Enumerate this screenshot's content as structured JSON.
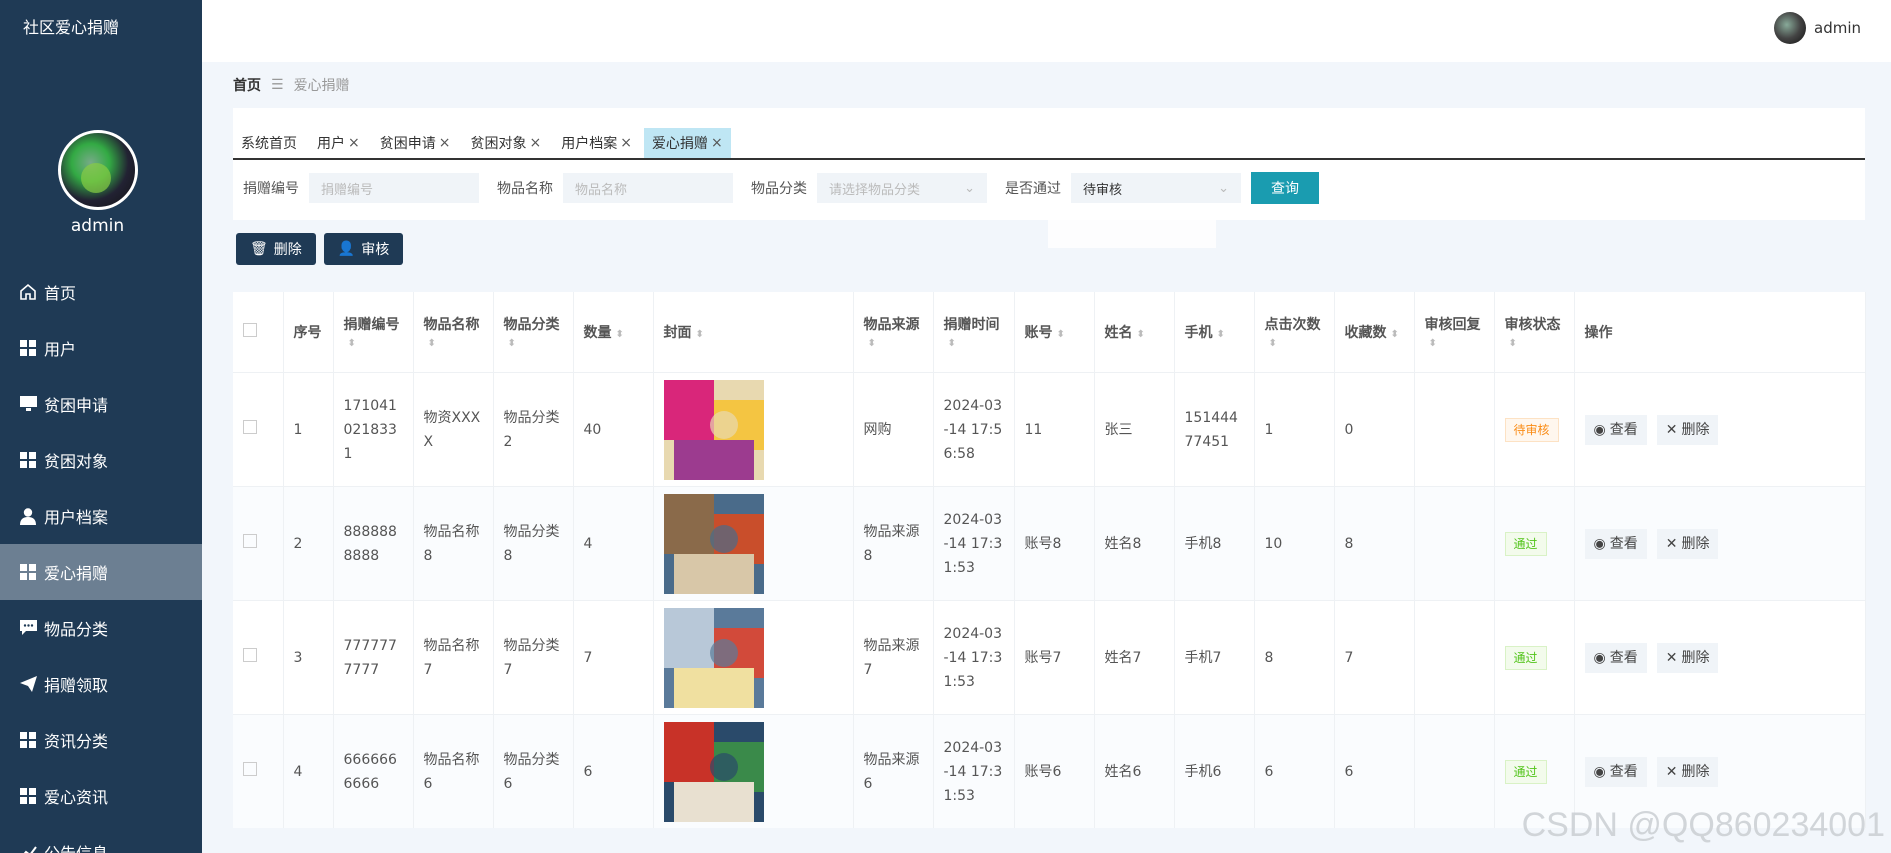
{
  "app": {
    "title": "社区爱心捐赠",
    "user": "admin"
  },
  "sidebar": {
    "items": [
      {
        "label": "首页",
        "icon": "home-icon"
      },
      {
        "label": "用户",
        "icon": "grid-icon"
      },
      {
        "label": "贫困申请",
        "icon": "monitor-icon"
      },
      {
        "label": "贫困对象",
        "icon": "grid-icon"
      },
      {
        "label": "用户档案",
        "icon": "user-icon"
      },
      {
        "label": "爱心捐赠",
        "icon": "grid-icon",
        "active": true
      },
      {
        "label": "物品分类",
        "icon": "chat-icon"
      },
      {
        "label": "捐赠领取",
        "icon": "send-icon"
      },
      {
        "label": "资讯分类",
        "icon": "grid-icon"
      },
      {
        "label": "爱心资讯",
        "icon": "grid-icon"
      },
      {
        "label": "公告信息",
        "icon": "chart-icon"
      }
    ]
  },
  "breadcrumb": {
    "home": "首页",
    "sep": "☰",
    "current": "爱心捐赠"
  },
  "tabs": [
    {
      "label": "系统首页",
      "closable": false
    },
    {
      "label": "用户",
      "closable": true
    },
    {
      "label": "贫困申请",
      "closable": true
    },
    {
      "label": "贫困对象",
      "closable": true
    },
    {
      "label": "用户档案",
      "closable": true
    },
    {
      "label": "爱心捐赠",
      "closable": true,
      "active": true
    }
  ],
  "search": {
    "donation_no_label": "捐赠编号",
    "donation_no_placeholder": "捐赠编号",
    "item_name_label": "物品名称",
    "item_name_placeholder": "物品名称",
    "category_label": "物品分类",
    "category_placeholder": "请选择物品分类",
    "approved_label": "是否通过",
    "approved_value": "待审核",
    "query_button": "查询"
  },
  "actions": {
    "delete": "删除",
    "audit": "审核"
  },
  "table": {
    "columns": [
      "序号",
      "捐赠编号",
      "物品名称",
      "物品分类",
      "数量",
      "封面",
      "物品来源",
      "捐赠时间",
      "账号",
      "姓名",
      "手机",
      "点击次数",
      "收藏数",
      "审核回复",
      "审核状态",
      "操作"
    ],
    "rows": [
      {
        "idx": "1",
        "no": "1710410218331",
        "name": "物资XXXX",
        "cat": "物品分类2",
        "qty": "40",
        "src": "网购",
        "time": "2024-03-14 17:56:58",
        "acct": "11",
        "person": "张三",
        "phone": "15144477451",
        "clicks": "1",
        "favs": "0",
        "reply": "",
        "status": "待审核",
        "status_kind": "pending"
      },
      {
        "idx": "2",
        "no": "8888888888",
        "name": "物品名称8",
        "cat": "物品分类8",
        "qty": "4",
        "src": "物品来源8",
        "time": "2024-03-14 17:31:53",
        "acct": "账号8",
        "person": "姓名8",
        "phone": "手机8",
        "clicks": "10",
        "favs": "8",
        "reply": "",
        "status": "通过",
        "status_kind": "pass"
      },
      {
        "idx": "3",
        "no": "7777777777",
        "name": "物品名称7",
        "cat": "物品分类7",
        "qty": "7",
        "src": "物品来源7",
        "time": "2024-03-14 17:31:53",
        "acct": "账号7",
        "person": "姓名7",
        "phone": "手机7",
        "clicks": "8",
        "favs": "7",
        "reply": "",
        "status": "通过",
        "status_kind": "pass"
      },
      {
        "idx": "4",
        "no": "6666666666",
        "name": "物品名称6",
        "cat": "物品分类6",
        "qty": "6",
        "src": "物品来源6",
        "time": "2024-03-14 17:31:53",
        "acct": "账号6",
        "person": "姓名6",
        "phone": "手机6",
        "clicks": "6",
        "favs": "6",
        "reply": "",
        "status": "通过",
        "status_kind": "pass"
      }
    ],
    "view_label": "查看",
    "delete_label": "删除"
  },
  "colors": {
    "sidebar": "#1f3a55",
    "accent": "#1a9cb0",
    "active_tab": "#bfe6f4",
    "pass": "#52c41a",
    "pending": "#fa8c16"
  },
  "watermark": "CSDN @QQ860234001"
}
